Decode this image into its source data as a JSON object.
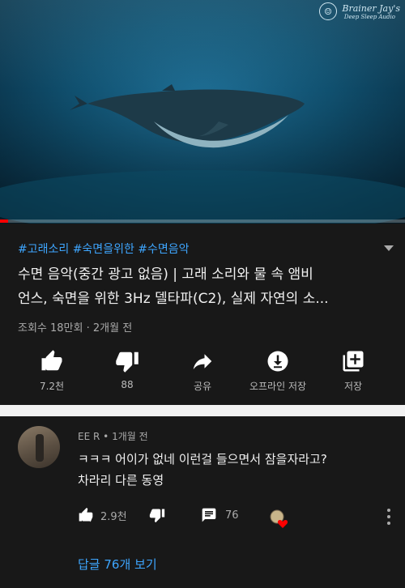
{
  "video": {
    "watermark_line1": "Brainer Jay's",
    "watermark_line2": "Deep Sleep Audio",
    "progress": 0.02
  },
  "info": {
    "hashtags": "#고래소리 #숙면을위한 #수면음악",
    "title_line1": "수면 음악(중간 광고 없음) | 고래 소리와 물 속 앰비",
    "title_line2": "언스, 숙면을 위한 3Hz 델타파(C2), 실제 자연의 소...",
    "meta": "조회수 18만회 · 2개월 전"
  },
  "actions": {
    "like": {
      "icon": "thumbs-up-icon",
      "label": "7.2천"
    },
    "dislike": {
      "icon": "thumbs-down-icon",
      "label": "88"
    },
    "share": {
      "icon": "share-icon",
      "label": "공유"
    },
    "offline": {
      "icon": "download-icon",
      "label": "오프라인 저장"
    },
    "save": {
      "icon": "add-to-playlist-icon",
      "label": "저장"
    }
  },
  "comment": {
    "author": "EE R",
    "time": "1개월 전",
    "text_line1": "ㅋㅋㅋ 어이가 없네 이런걸 들으면서 잠을자라고?",
    "text_line2": "차라리 다른 동영",
    "likes": "2.9천",
    "reply_count": "76",
    "view_replies": "답글 76개 보기"
  },
  "colors": {
    "accent_link": "#3ea6ff",
    "background": "#181818",
    "progress": "#ff0000",
    "heart": "#ff0000"
  }
}
